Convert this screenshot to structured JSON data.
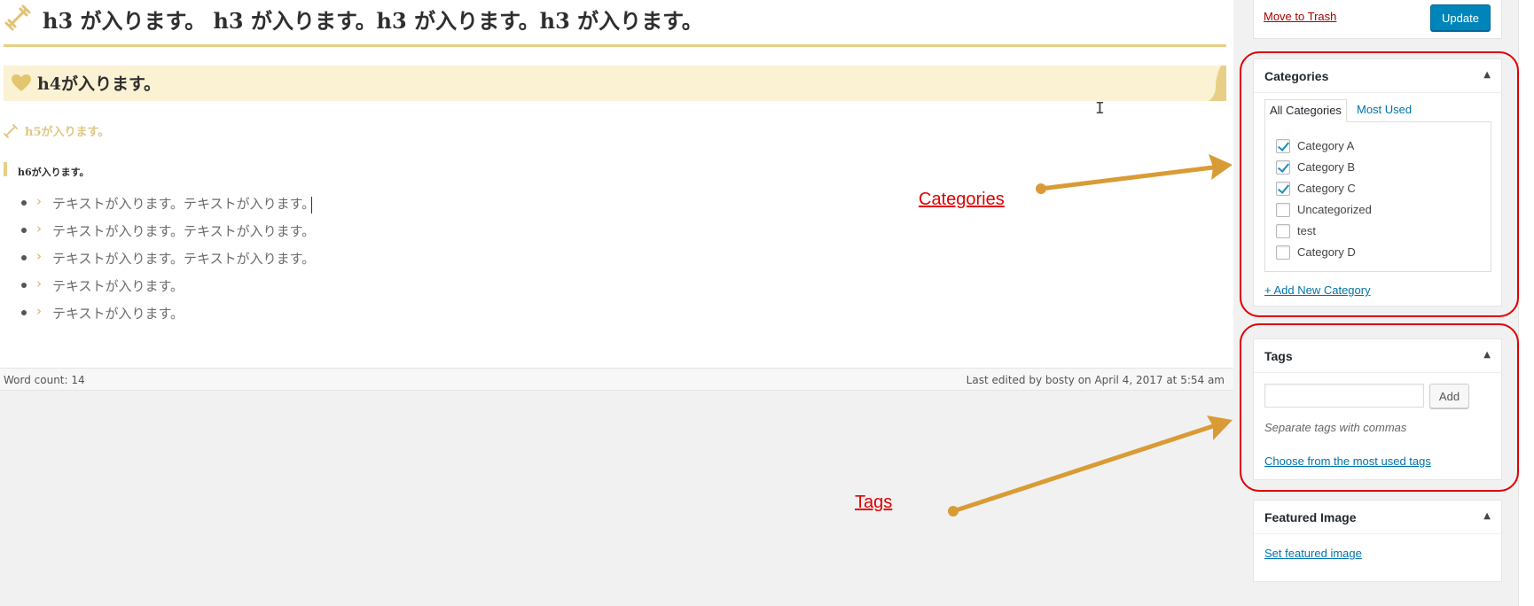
{
  "editor": {
    "h3": "h3 が入ります。 h3 が入ります。h3 が入ります。h3 が入ります。",
    "h4": "h4が入ります。",
    "h5": "h5が入ります。",
    "h6": "h6が入ります。",
    "list_items": [
      "テキストが入ります。テキストが入ります。",
      "テキストが入ります。テキストが入ります。",
      "テキストが入ります。テキストが入ります。",
      "テキストが入ります。",
      "テキストが入ります。"
    ],
    "bullet_chevron": "›"
  },
  "status_bar": {
    "word_count": "Word count: 14",
    "last_edited": "Last edited by bosty on April 4, 2017 at 5:54 am"
  },
  "annotations": {
    "categories_label": "Categories",
    "tags_label": "Tags",
    "arrow_color": "#d99b35",
    "frame_color": "#e00000"
  },
  "publish": {
    "trash_label": "Move to Trash",
    "update_label": "Update"
  },
  "categories": {
    "title": "Categories",
    "toggle": "▲",
    "tabs": [
      "All Categories",
      "Most Used"
    ],
    "items": [
      {
        "label": "Category A",
        "checked": true
      },
      {
        "label": "Category B",
        "checked": true
      },
      {
        "label": "Category C",
        "checked": true
      },
      {
        "label": "Uncategorized",
        "checked": false
      },
      {
        "label": "test",
        "checked": false
      },
      {
        "label": "Category D",
        "checked": false
      }
    ],
    "add_new": "+ Add New Category"
  },
  "tags": {
    "title": "Tags",
    "toggle": "▲",
    "input_value": "",
    "add_label": "Add",
    "hint": "Separate tags with commas",
    "choose_link": "Choose from the most used tags"
  },
  "featured_image": {
    "title": "Featured Image",
    "toggle": "▲",
    "set_link": "Set featured image"
  },
  "colors": {
    "accent_gold": "#e8cf85",
    "link_blue": "#0073aa",
    "primary_button": "#0085ba",
    "danger_red": "#a00"
  }
}
